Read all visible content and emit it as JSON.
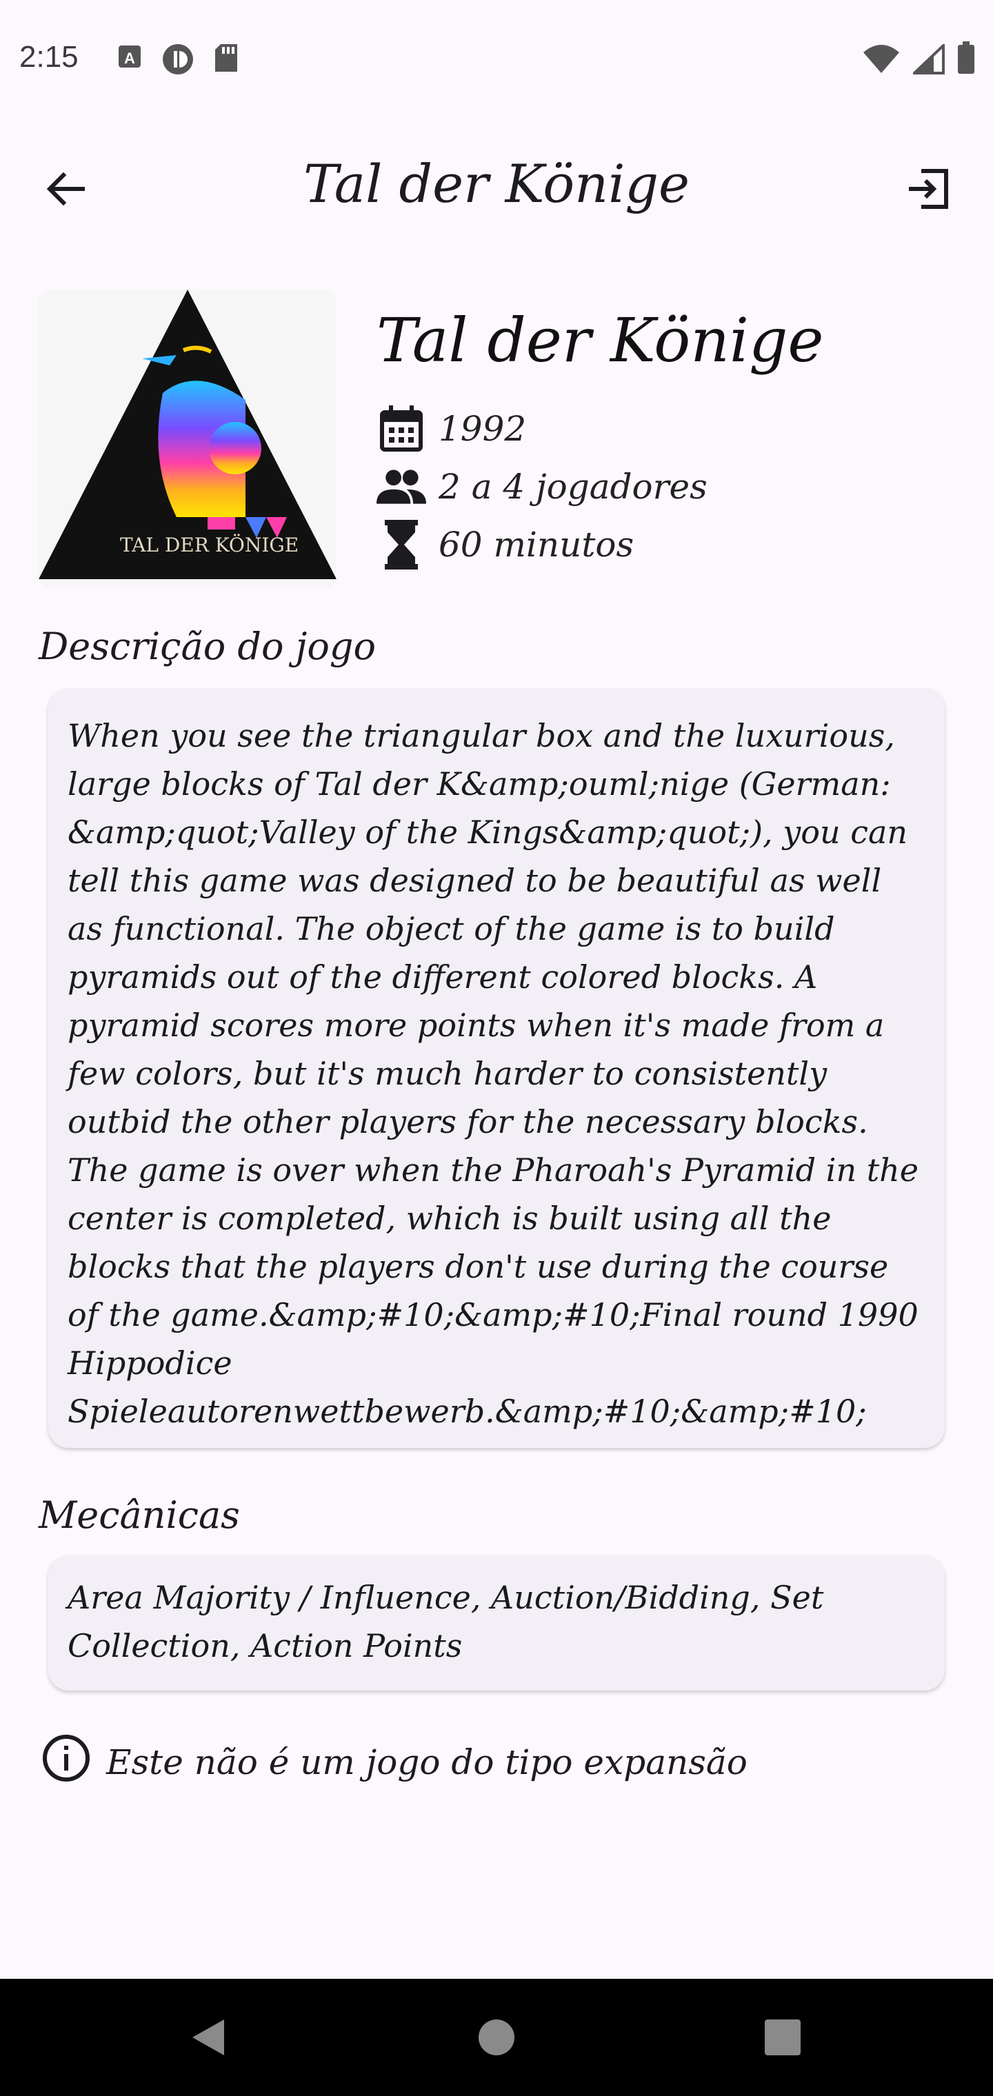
{
  "status_bar": {
    "time": "2:15",
    "left_icons": [
      "a-icon",
      "vpn-icon",
      "sd-card-icon"
    ],
    "right_icons": [
      "wifi-icon",
      "signal-icon",
      "battery-icon"
    ]
  },
  "app_bar": {
    "title": "Tal der Könige",
    "back_icon": "arrow-back-icon",
    "exit_icon": "exit-icon"
  },
  "game": {
    "name": "Tal der Könige",
    "cover_text": "TAL DER KÖNIGE",
    "year": "1992",
    "players": "2 a 4 jogadores",
    "duration": "60 minutos"
  },
  "description": {
    "title": "Descrição do jogo",
    "text": "When you see the triangular box and the luxurious, large blocks of Tal der K&amp;ouml;nige (German: &amp;quot;Valley of the Kings&amp;quot;), you can tell this game was designed to be beautiful as well as functional.  The object of the game is to build pyramids out of the different colored blocks.  A pyramid scores more points when it's made from a few colors, but it's much harder to consistently outbid the other players for the necessary blocks.  The game is over when the Pharoah's Pyramid in the center is completed, which is built using all the blocks that the players don't use during the course of the game.&amp;#10;&amp;#10;Final round 1990 Hippodice Spieleautorenwettbewerb.&amp;#10;&amp;#10;"
  },
  "mechanics": {
    "title": "Mecânicas",
    "text": "Area Majority / Influence, Auction/Bidding, Set Collection, Action Points"
  },
  "expansion_info": {
    "text": "Este não é um jogo do tipo expansão"
  },
  "colors": {
    "background": "#fdf8fd",
    "card": "#f3eff6",
    "nav_bar": "#000000"
  }
}
